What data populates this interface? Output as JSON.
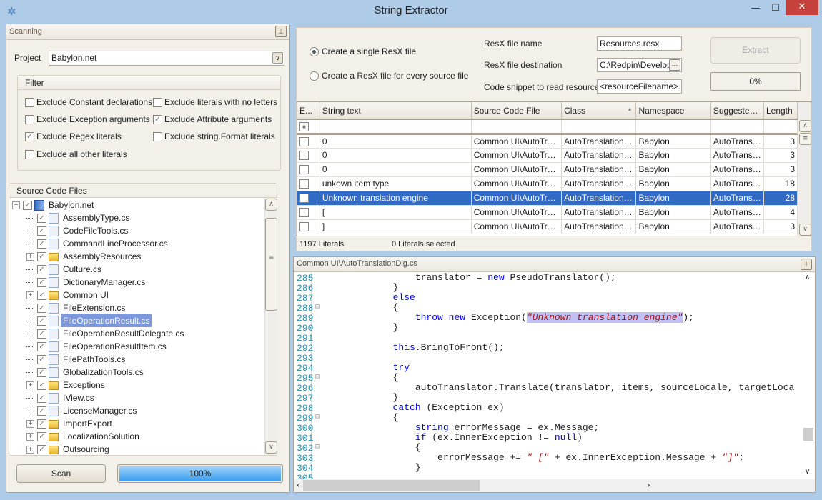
{
  "window": {
    "title": "String Extractor",
    "icon": "app-star-icon",
    "minimize": "—",
    "maximize": "☐",
    "close": "✕"
  },
  "scanning": {
    "header": "Scanning",
    "project_label": "Project",
    "project_value": "Babylon.net",
    "filter": {
      "title": "Filter",
      "options": [
        {
          "label": "Exclude Constant declarations",
          "checked": false
        },
        {
          "label": "Exclude literals with no letters",
          "checked": false
        },
        {
          "label": "Exclude Exception arguments",
          "checked": false
        },
        {
          "label": "Exclude Attribute arguments",
          "checked": true
        },
        {
          "label": "Exclude Regex literals",
          "checked": true
        },
        {
          "label": "Exclude string.Format literals",
          "checked": false
        },
        {
          "label": "Exclude all other literals",
          "checked": false
        }
      ]
    },
    "source_files": {
      "title": "Source Code Files",
      "root": "Babylon.net",
      "items": [
        {
          "name": "AssemblyType.cs",
          "type": "file"
        },
        {
          "name": "CodeFileTools.cs",
          "type": "file"
        },
        {
          "name": "CommandLineProcessor.cs",
          "type": "file"
        },
        {
          "name": "AssemblyResources",
          "type": "folder"
        },
        {
          "name": "Culture.cs",
          "type": "file"
        },
        {
          "name": "DictionaryManager.cs",
          "type": "file"
        },
        {
          "name": "Common UI",
          "type": "folder"
        },
        {
          "name": "FileExtension.cs",
          "type": "file"
        },
        {
          "name": "FileOperationResult.cs",
          "type": "file",
          "selected": true
        },
        {
          "name": "FileOperationResultDelegate.cs",
          "type": "file"
        },
        {
          "name": "FileOperationResultItem.cs",
          "type": "file"
        },
        {
          "name": "FilePathTools.cs",
          "type": "file"
        },
        {
          "name": "GlobalizationTools.cs",
          "type": "file"
        },
        {
          "name": "Exceptions",
          "type": "folder"
        },
        {
          "name": "IView.cs",
          "type": "file"
        },
        {
          "name": "LicenseManager.cs",
          "type": "file"
        },
        {
          "name": "ImportExport",
          "type": "folder"
        },
        {
          "name": "LocalizationSolution",
          "type": "folder"
        },
        {
          "name": "Outsourcing",
          "type": "folder"
        }
      ]
    },
    "scan_button": "Scan",
    "scan_progress": "100%",
    "scan_progress_value": 100
  },
  "extract": {
    "radio_single": "Create a single ResX file",
    "radio_every": "Create a ResX file for every source file",
    "selected_mode": "single",
    "resx_name_label": "ResX file name",
    "resx_name": "Resources.resx",
    "resx_dest_label": "ResX file destination",
    "resx_dest": "C:\\Redpin\\Developr",
    "browse": "···",
    "snippet_label": "Code snippet to read resources",
    "snippet": "<resourceFilename>.<",
    "extract_button": "Extract",
    "progress": "0%",
    "progress_value": 0
  },
  "grid": {
    "columns": [
      "E...",
      "String text",
      "Source Code File",
      "Class",
      "Namespace",
      "Suggested Reso...",
      "Length"
    ],
    "sort_column": "Class",
    "sort_dir": "asc",
    "rows": [
      {
        "text": "0",
        "file": "Common UI\\AutoTra...",
        "cls": "AutoTranslationDlg",
        "ns": "Babylon",
        "res": "AutoTranslation...",
        "len": "3"
      },
      {
        "text": "0",
        "file": "Common UI\\AutoTra...",
        "cls": "AutoTranslationDlg",
        "ns": "Babylon",
        "res": "AutoTranslation...",
        "len": "3"
      },
      {
        "text": "0",
        "file": "Common UI\\AutoTra...",
        "cls": "AutoTranslationDlg",
        "ns": "Babylon",
        "res": "AutoTranslation...",
        "len": "3"
      },
      {
        "text": "unkown item type",
        "file": "Common UI\\AutoTra...",
        "cls": "AutoTranslationDlg",
        "ns": "Babylon",
        "res": "AutoTranslation...",
        "len": "18"
      },
      {
        "text": "Unknown translation engine",
        "file": "Common UI\\AutoTra...",
        "cls": "AutoTranslationDlg",
        "ns": "Babylon",
        "res": "AutoTranslation...",
        "len": "28",
        "selected": true
      },
      {
        "text": " [",
        "file": "Common UI\\AutoTra...",
        "cls": "AutoTranslationDlg",
        "ns": "Babylon",
        "res": "AutoTranslation...",
        "len": "4"
      },
      {
        "text": "]",
        "file": "Common UI\\AutoTra...",
        "cls": "AutoTranslationDlg",
        "ns": "Babylon",
        "res": "AutoTranslation...",
        "len": "3"
      }
    ],
    "literal_count": "1197 Literals",
    "selected_count": "0 Literals selected"
  },
  "code": {
    "header": "Common UI\\AutoTranslationDlg.cs",
    "lines": [
      {
        "n": "285",
        "t": [
          [
            "                translator = ",
            ""
          ],
          [
            "new",
            "kw"
          ],
          [
            " PseudoTranslator();",
            ""
          ]
        ]
      },
      {
        "n": "286",
        "t": [
          [
            "            }",
            ""
          ]
        ]
      },
      {
        "n": "287",
        "t": [
          [
            "            ",
            ""
          ],
          [
            "else",
            "kw"
          ]
        ]
      },
      {
        "n": "288",
        "t": [
          [
            "            {",
            ""
          ]
        ],
        "fold": true
      },
      {
        "n": "289",
        "t": [
          [
            "                ",
            ""
          ],
          [
            "throw",
            "kw"
          ],
          [
            " ",
            ""
          ],
          [
            "new",
            "kw"
          ],
          [
            " Exception(",
            ""
          ],
          [
            "\"Unknown translation engine\"",
            "str hl"
          ],
          [
            ");",
            ""
          ]
        ]
      },
      {
        "n": "290",
        "t": [
          [
            "            }",
            ""
          ]
        ]
      },
      {
        "n": "291",
        "t": []
      },
      {
        "n": "292",
        "t": [
          [
            "            ",
            ""
          ],
          [
            "this",
            "kw"
          ],
          [
            ".BringToFront();",
            ""
          ]
        ]
      },
      {
        "n": "293",
        "t": []
      },
      {
        "n": "294",
        "t": [
          [
            "            ",
            ""
          ],
          [
            "try",
            "kw"
          ]
        ]
      },
      {
        "n": "295",
        "t": [
          [
            "            {",
            ""
          ]
        ],
        "fold": true
      },
      {
        "n": "296",
        "t": [
          [
            "                autoTranslator.Translate(translator, items, sourceLocale, targetLoca",
            ""
          ]
        ]
      },
      {
        "n": "297",
        "t": [
          [
            "            }",
            ""
          ]
        ]
      },
      {
        "n": "298",
        "t": [
          [
            "            ",
            ""
          ],
          [
            "catch",
            "kw"
          ],
          [
            " (Exception ex)",
            ""
          ]
        ]
      },
      {
        "n": "299",
        "t": [
          [
            "            {",
            ""
          ]
        ],
        "fold": true
      },
      {
        "n": "300",
        "t": [
          [
            "                ",
            ""
          ],
          [
            "string",
            "kw"
          ],
          [
            " errorMessage = ex.Message;",
            ""
          ]
        ]
      },
      {
        "n": "301",
        "t": [
          [
            "                ",
            ""
          ],
          [
            "if",
            "kw"
          ],
          [
            " (ex.InnerException != ",
            ""
          ],
          [
            "null",
            "kw"
          ],
          [
            ")",
            ""
          ]
        ]
      },
      {
        "n": "302",
        "t": [
          [
            "                {",
            ""
          ]
        ],
        "fold": true
      },
      {
        "n": "303",
        "t": [
          [
            "                    errorMessage += ",
            ""
          ],
          [
            "\" [\"",
            "str"
          ],
          [
            " + ex.InnerException.Message + ",
            ""
          ],
          [
            "\"]\"",
            "str"
          ],
          [
            ";",
            ""
          ]
        ]
      },
      {
        "n": "304",
        "t": [
          [
            "                }",
            ""
          ]
        ]
      },
      {
        "n": "305",
        "t": []
      }
    ]
  },
  "colors": {
    "accent": "#316ac5",
    "tree_selection": "#7b97de",
    "frame": "#aecbe8",
    "close": "#c7413c"
  }
}
